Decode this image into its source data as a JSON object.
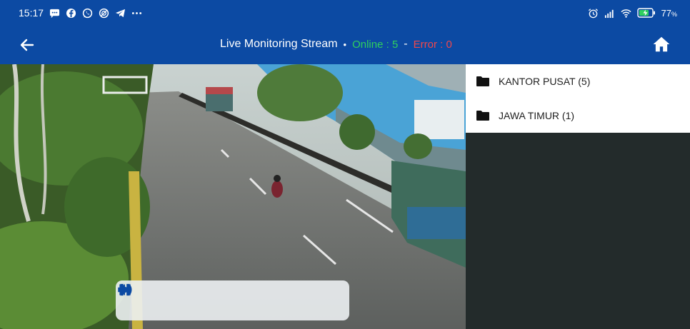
{
  "status_bar": {
    "time": "15:17",
    "battery_percent": "77",
    "battery_suffix": "%",
    "icons_left": [
      "message-icon",
      "facebook-icon",
      "whatsapp-icon",
      "no-sign-icon",
      "telegram-icon",
      "more-icon"
    ],
    "icons_right": [
      "alarm-icon",
      "signal-icon",
      "wifi-icon",
      "battery-charging-icon"
    ]
  },
  "app_bar": {
    "title": "Live Monitoring Stream",
    "separator": "•",
    "online_label": "Online : 5",
    "dash": "-",
    "error_label": "Error : 0",
    "back_icon": "arrow-left-icon",
    "home_icon": "home-icon"
  },
  "folders": [
    {
      "label": "KANTOR PUSAT (5)"
    },
    {
      "label": "JAWA TIMUR (1)"
    }
  ],
  "controls": [
    "volume-icon",
    "play-icon",
    "pause-icon",
    "skip-previous-icon",
    "skip-next-icon"
  ],
  "colors": {
    "brand": "#0c4aa3",
    "online": "#2fcf5e",
    "error": "#f0474b",
    "panel_dark": "#232b2b"
  }
}
